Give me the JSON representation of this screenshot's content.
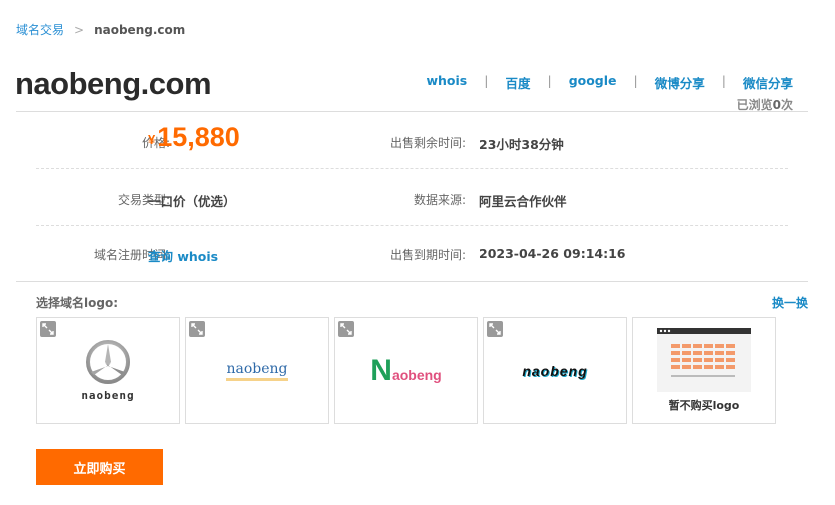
{
  "breadcrumb": {
    "parent": "域名交易",
    "separator": ">",
    "current": "naobeng.com"
  },
  "domain": "naobeng.com",
  "share": [
    "whois",
    "百度",
    "google",
    "微博分享",
    "微信分享"
  ],
  "views": {
    "prefix": "已浏览",
    "count": "0",
    "suffix": "次"
  },
  "info": {
    "price_label": "价格:",
    "price_currency": "¥",
    "price_value": "15,880",
    "remaining_label": "出售剩余时间:",
    "remaining_value": "23小时38分钟",
    "trade_type_label": "交易类型:",
    "trade_type_value": "一口价（优选）",
    "source_label": "数据来源:",
    "source_value": "阿里云合作伙伴",
    "reg_time_label": "域名注册时间:",
    "reg_time_link": "查询 whois",
    "expire_label": "出售到期时间:",
    "expire_value": "2023-04-26 09:14:16"
  },
  "logo_section": {
    "title": "选择域名logo:",
    "swap": "换一换",
    "logos": [
      {
        "text": "naobeng",
        "icon": "star-emblem-icon"
      },
      {
        "text": "naobeng"
      },
      {
        "text_first": "N",
        "text_rest": "aobeng"
      },
      {
        "text": "naobeng"
      },
      {
        "text": "暂不购买logo",
        "icon": "grid-placeholder-icon"
      }
    ]
  },
  "colors": {
    "accent": "#ff6a00",
    "link": "#1a8ac6"
  },
  "buy_button": "立即购买"
}
